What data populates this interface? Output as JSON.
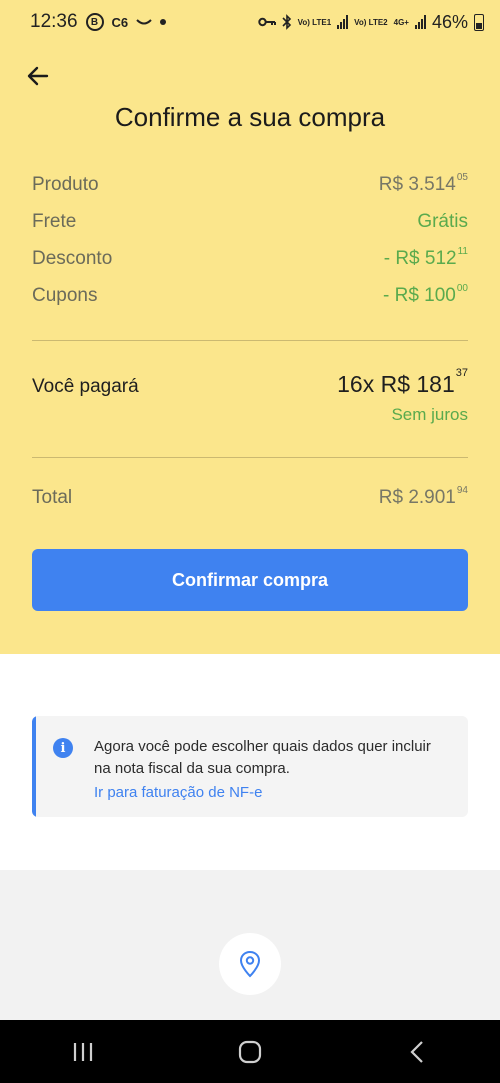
{
  "status_bar": {
    "time": "12:36",
    "icon_b": "B",
    "carrier": "C6",
    "network1": "Vo) LTE1",
    "network2": "Vo) LTE2",
    "network3": "4G+",
    "battery": "46%"
  },
  "header": {
    "title": "Confirme a sua compra"
  },
  "summary": {
    "product": {
      "label": "Produto",
      "amount": "R$ 3.514",
      "cents": "05"
    },
    "shipping": {
      "label": "Frete",
      "amount": "Grátis"
    },
    "discount": {
      "label": "Desconto",
      "amount": "- R$ 512",
      "cents": "11"
    },
    "coupons": {
      "label": "Cupons",
      "amount": "- R$ 100",
      "cents": "00"
    },
    "payment": {
      "label": "Você pagará",
      "amount": "16x R$ 181",
      "cents": "37",
      "note": "Sem juros"
    },
    "total": {
      "label": "Total",
      "amount": "R$ 2.901",
      "cents": "94"
    }
  },
  "confirm_button": "Confirmar compra",
  "info_card": {
    "text": "Agora você pode escolher quais dados quer incluir na nota fiscal da sua compra.",
    "link": "Ir para faturação de NF-e"
  },
  "colors": {
    "yellow": "#fbe68c",
    "blue": "#3f82f0",
    "green": "#5aaa4d"
  },
  "icons": {
    "back": "arrow-left-icon",
    "info": "info-icon",
    "location": "location-pin-icon"
  }
}
